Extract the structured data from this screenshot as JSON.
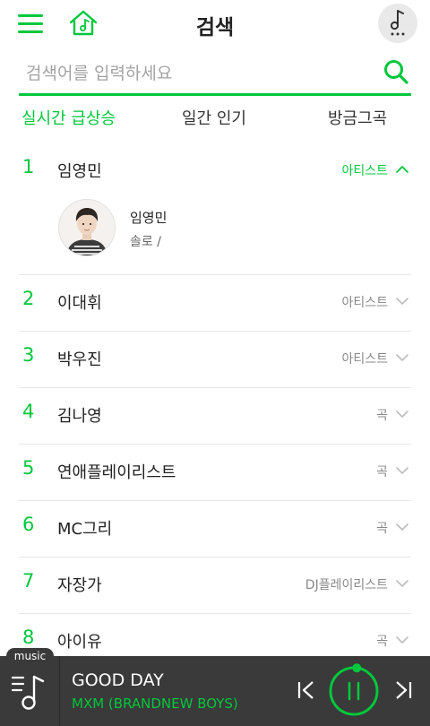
{
  "header": {
    "title": "검색",
    "menu_icon": "hamburger-menu-icon",
    "home_icon": "music-home-icon",
    "player_icon": "music-note-more-icon"
  },
  "search": {
    "placeholder": "검색어를 입력하세요",
    "value": "",
    "icon": "search-icon"
  },
  "tabs": [
    {
      "label": "실시간 급상승",
      "active": true
    },
    {
      "label": "일간 인기",
      "active": false
    },
    {
      "label": "방금그곡",
      "active": false
    }
  ],
  "ranking": [
    {
      "rank": "1",
      "title": "임영민",
      "type": "아티스트",
      "expanded": true
    },
    {
      "rank": "2",
      "title": "이대휘",
      "type": "아티스트"
    },
    {
      "rank": "3",
      "title": "박우진",
      "type": "아티스트"
    },
    {
      "rank": "4",
      "title": "김나영",
      "type": "곡"
    },
    {
      "rank": "5",
      "title": "연애플레이리스트",
      "type": "곡"
    },
    {
      "rank": "6",
      "title": "MC그리",
      "type": "곡"
    },
    {
      "rank": "7",
      "title": "자장가",
      "type": "DJ플레이리스트"
    },
    {
      "rank": "8",
      "title": "아이유",
      "type": "곡"
    }
  ],
  "expanded_artist": {
    "name": "임영민",
    "meta": "솔로 /"
  },
  "player": {
    "badge": "music",
    "track_title": "GOOD DAY",
    "track_artist": "MXM (BRANDNEW BOYS)",
    "progress": 0.02
  },
  "colors": {
    "accent": "#00c73c",
    "player_bg": "#3a3a3a"
  }
}
